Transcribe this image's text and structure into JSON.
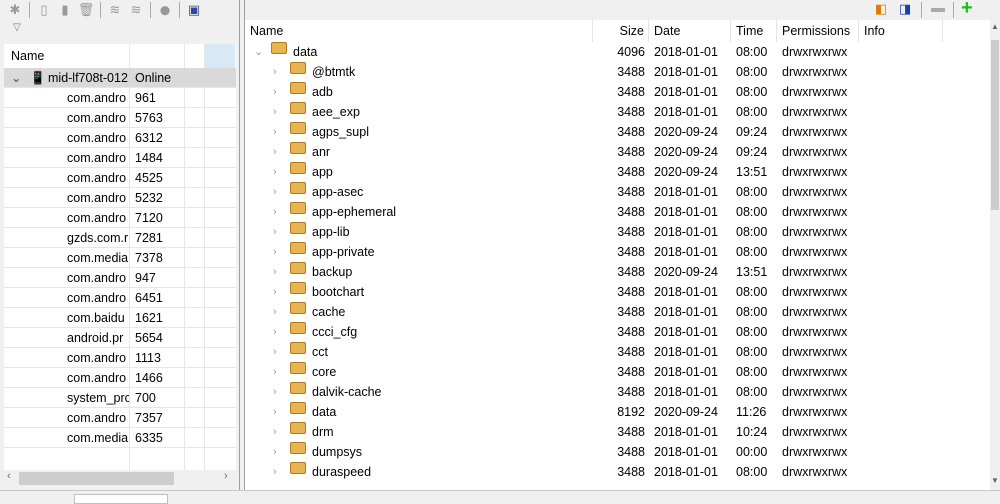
{
  "left": {
    "toolbar_icons": [
      "debug-icon",
      "heap-update-icon",
      "heap-dump-icon",
      "gc-icon",
      "thread-update-icon",
      "method-profile-icon",
      "stop-icon",
      "screen-capture-icon"
    ],
    "headers": [
      "Name",
      "",
      "",
      ""
    ],
    "device": {
      "name": "mid-lf708t-012",
      "status": "Online"
    },
    "processes": [
      {
        "name": "com.andro",
        "pid": "961"
      },
      {
        "name": "com.andro",
        "pid": "5763"
      },
      {
        "name": "com.andro",
        "pid": "6312"
      },
      {
        "name": "com.andro",
        "pid": "1484"
      },
      {
        "name": "com.andro",
        "pid": "4525"
      },
      {
        "name": "com.andro",
        "pid": "5232"
      },
      {
        "name": "com.andro",
        "pid": "7120"
      },
      {
        "name": "gzds.com.r",
        "pid": "7281"
      },
      {
        "name": "com.media",
        "pid": "7378"
      },
      {
        "name": "com.andro",
        "pid": "947"
      },
      {
        "name": "com.andro",
        "pid": "6451"
      },
      {
        "name": "com.baidu",
        "pid": "1621"
      },
      {
        "name": "android.pr",
        "pid": "5654"
      },
      {
        "name": "com.andro",
        "pid": "1113"
      },
      {
        "name": "com.andro",
        "pid": "1466"
      },
      {
        "name": "system_prc",
        "pid": "700"
      },
      {
        "name": "com.andro",
        "pid": "7357"
      },
      {
        "name": "com.media",
        "pid": "6335"
      }
    ]
  },
  "right": {
    "toolbar_icons": [
      "pull-file-icon",
      "push-file-icon",
      "delete-icon",
      "new-folder-icon"
    ],
    "headers": {
      "name": "Name",
      "size": "Size",
      "date": "Date",
      "time": "Time",
      "permissions": "Permissions",
      "info": "Info"
    },
    "root": {
      "name": "data",
      "size": "4096",
      "date": "2018-01-01",
      "time": "08:00",
      "permissions": "drwxrwxrwx"
    },
    "entries": [
      {
        "name": "@btmtk",
        "size": "3488",
        "date": "2018-01-01",
        "time": "08:00",
        "permissions": "drwxrwxrwx"
      },
      {
        "name": "adb",
        "size": "3488",
        "date": "2018-01-01",
        "time": "08:00",
        "permissions": "drwxrwxrwx"
      },
      {
        "name": "aee_exp",
        "size": "3488",
        "date": "2018-01-01",
        "time": "08:00",
        "permissions": "drwxrwxrwx"
      },
      {
        "name": "agps_supl",
        "size": "3488",
        "date": "2020-09-24",
        "time": "09:24",
        "permissions": "drwxrwxrwx"
      },
      {
        "name": "anr",
        "size": "3488",
        "date": "2020-09-24",
        "time": "09:24",
        "permissions": "drwxrwxrwx"
      },
      {
        "name": "app",
        "size": "3488",
        "date": "2020-09-24",
        "time": "13:51",
        "permissions": "drwxrwxrwx"
      },
      {
        "name": "app-asec",
        "size": "3488",
        "date": "2018-01-01",
        "time": "08:00",
        "permissions": "drwxrwxrwx"
      },
      {
        "name": "app-ephemeral",
        "size": "3488",
        "date": "2018-01-01",
        "time": "08:00",
        "permissions": "drwxrwxrwx"
      },
      {
        "name": "app-lib",
        "size": "3488",
        "date": "2018-01-01",
        "time": "08:00",
        "permissions": "drwxrwxrwx"
      },
      {
        "name": "app-private",
        "size": "3488",
        "date": "2018-01-01",
        "time": "08:00",
        "permissions": "drwxrwxrwx"
      },
      {
        "name": "backup",
        "size": "3488",
        "date": "2020-09-24",
        "time": "13:51",
        "permissions": "drwxrwxrwx"
      },
      {
        "name": "bootchart",
        "size": "3488",
        "date": "2018-01-01",
        "time": "08:00",
        "permissions": "drwxrwxrwx"
      },
      {
        "name": "cache",
        "size": "3488",
        "date": "2018-01-01",
        "time": "08:00",
        "permissions": "drwxrwxrwx"
      },
      {
        "name": "ccci_cfg",
        "size": "3488",
        "date": "2018-01-01",
        "time": "08:00",
        "permissions": "drwxrwxrwx"
      },
      {
        "name": "cct",
        "size": "3488",
        "date": "2018-01-01",
        "time": "08:00",
        "permissions": "drwxrwxrwx"
      },
      {
        "name": "core",
        "size": "3488",
        "date": "2018-01-01",
        "time": "08:00",
        "permissions": "drwxrwxrwx"
      },
      {
        "name": "dalvik-cache",
        "size": "3488",
        "date": "2018-01-01",
        "time": "08:00",
        "permissions": "drwxrwxrwx"
      },
      {
        "name": "data",
        "size": "8192",
        "date": "2020-09-24",
        "time": "11:26",
        "permissions": "drwxrwxrwx"
      },
      {
        "name": "drm",
        "size": "3488",
        "date": "2018-01-01",
        "time": "10:24",
        "permissions": "drwxrwxrwx"
      },
      {
        "name": "dumpsys",
        "size": "3488",
        "date": "2018-01-01",
        "time": "00:00",
        "permissions": "drwxrwxrwx"
      },
      {
        "name": "duraspeed",
        "size": "3488",
        "date": "2018-01-01",
        "time": "08:00",
        "permissions": "drwxrwxrwx"
      }
    ]
  },
  "colors": {
    "selected_row": "#d9d9d9",
    "folder": "#e8b452",
    "header_highlight": "#d8e8f7",
    "add": "#16c016"
  }
}
